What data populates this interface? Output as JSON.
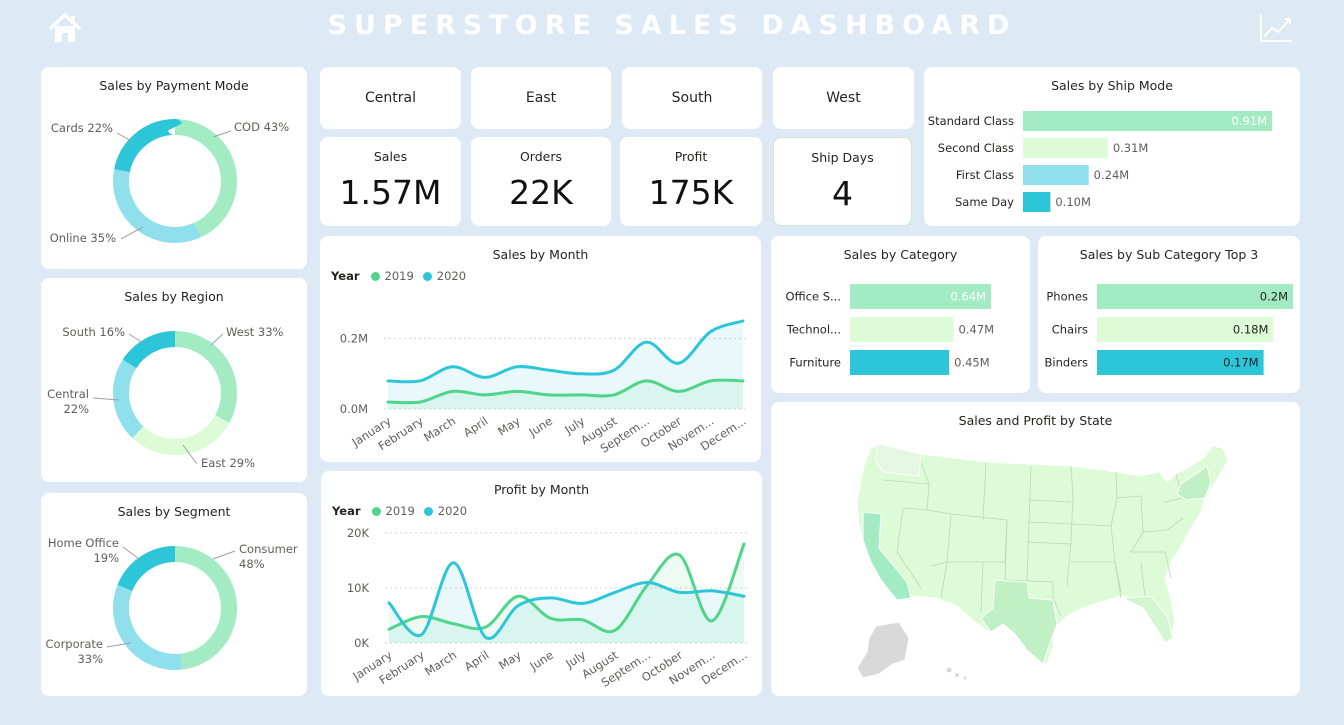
{
  "header": {
    "title": "SUPERSTORE SALES DASHBOARD",
    "home_icon": "home-icon",
    "trend_icon": "line-chart-icon"
  },
  "colors": {
    "background": "#dde9f5",
    "mint": "#a3ecc3",
    "pale_green": "#dcfbd6",
    "light_cyan": "#8fe0ec",
    "cyan": "#2cc6d8",
    "series_2019": "#4fd48a",
    "series_2020": "#2cc6d8"
  },
  "regions": [
    "Central",
    "East",
    "South",
    "West"
  ],
  "kpis": [
    {
      "label": "Sales",
      "value": "1.57M"
    },
    {
      "label": "Orders",
      "value": "22K"
    },
    {
      "label": "Profit",
      "value": "175K"
    },
    {
      "label": "Ship Days",
      "value": "4"
    }
  ],
  "donuts": {
    "payment": {
      "title": "Sales by Payment Mode",
      "slices": [
        {
          "label": "COD 43%",
          "value": 43,
          "color": "#a3ecc3"
        },
        {
          "label": "Online 35%",
          "value": 35,
          "color": "#8fe0ec"
        },
        {
          "label": "Cards 22%",
          "value": 22,
          "color": "#2cc6d8"
        }
      ]
    },
    "region": {
      "title": "Sales by Region",
      "slices": [
        {
          "label": "West 33%",
          "value": 33,
          "color": "#a3ecc3"
        },
        {
          "label": "East 29%",
          "value": 29,
          "color": "#dcfbd6"
        },
        {
          "label": "Central 22%",
          "value": 22,
          "color": "#8fe0ec"
        },
        {
          "label": "South 16%",
          "value": 16,
          "color": "#2cc6d8"
        }
      ]
    },
    "segment": {
      "title": "Sales by Segment",
      "slices": [
        {
          "label": "Consumer 48%",
          "value": 48,
          "color": "#a3ecc3"
        },
        {
          "label": "Corporate 33%",
          "value": 33,
          "color": "#8fe0ec"
        },
        {
          "label": "Home Office 19%",
          "value": 19,
          "color": "#2cc6d8"
        }
      ]
    }
  },
  "chart_data": [
    {
      "id": "sales-by-ship-mode",
      "type": "bar",
      "orientation": "horizontal",
      "title": "Sales by Ship Mode",
      "categories": [
        "Standard Class",
        "Second Class",
        "First Class",
        "Same Day"
      ],
      "values": [
        0.91,
        0.31,
        0.24,
        0.1
      ],
      "labels": [
        "0.91M",
        "0.31M",
        "0.24M",
        "0.10M"
      ],
      "colors": [
        "#a3ecc3",
        "#dcfbd6",
        "#8fe0ec",
        "#2cc6d8"
      ],
      "xlim": [
        0,
        0.91
      ]
    },
    {
      "id": "sales-by-category",
      "type": "bar",
      "orientation": "horizontal",
      "title": "Sales by Category",
      "categories": [
        "Office S...",
        "Technol...",
        "Furniture"
      ],
      "values": [
        0.64,
        0.47,
        0.45
      ],
      "labels": [
        "0.64M",
        "0.47M",
        "0.45M"
      ],
      "colors": [
        "#a3ecc3",
        "#dcfbd6",
        "#2cc6d8"
      ],
      "xlim": [
        0,
        0.64
      ]
    },
    {
      "id": "sales-by-subcategory",
      "type": "bar",
      "orientation": "horizontal",
      "title": "Sales by Sub Category Top 3",
      "categories": [
        "Phones",
        "Chairs",
        "Binders"
      ],
      "values": [
        0.2,
        0.18,
        0.17
      ],
      "labels": [
        "0.2M",
        "0.18M",
        "0.17M"
      ],
      "colors": [
        "#a3ecc3",
        "#dcfbd6",
        "#2cc6d8"
      ],
      "xlim": [
        0,
        0.2
      ]
    },
    {
      "id": "sales-by-month",
      "type": "area",
      "title": "Sales by Month",
      "legend_title": "Year",
      "categories": [
        "January",
        "February",
        "March",
        "April",
        "May",
        "June",
        "July",
        "August",
        "Septem...",
        "October",
        "Novem...",
        "Decem..."
      ],
      "series": [
        {
          "name": "2019",
          "values": [
            0.02,
            0.02,
            0.05,
            0.04,
            0.05,
            0.04,
            0.04,
            0.04,
            0.08,
            0.05,
            0.08,
            0.08
          ],
          "color": "#4fd48a"
        },
        {
          "name": "2020",
          "values": [
            0.08,
            0.08,
            0.12,
            0.09,
            0.12,
            0.11,
            0.1,
            0.11,
            0.19,
            0.13,
            0.22,
            0.25
          ],
          "color": "#2cc6d8"
        }
      ],
      "y_ticks": [
        "0.0M",
        "0.2M"
      ],
      "ylim": [
        0,
        0.25
      ]
    },
    {
      "id": "profit-by-month",
      "type": "area",
      "title": "Profit by Month",
      "legend_title": "Year",
      "categories": [
        "January",
        "February",
        "March",
        "April",
        "May",
        "June",
        "July",
        "August",
        "Septem...",
        "October",
        "Novem...",
        "Decem..."
      ],
      "series": [
        {
          "name": "2019",
          "values": [
            2500,
            4800,
            3500,
            2900,
            8500,
            4500,
            4200,
            2300,
            10500,
            16000,
            4000,
            18000
          ],
          "color": "#4fd48a"
        },
        {
          "name": "2020",
          "values": [
            7300,
            1500,
            14600,
            1000,
            6800,
            8200,
            7200,
            9200,
            11000,
            9200,
            9500,
            8500
          ],
          "color": "#2cc6d8"
        }
      ],
      "y_ticks": [
        "0K",
        "10K",
        "20K"
      ],
      "ylim": [
        0,
        20000
      ]
    }
  ],
  "map": {
    "title": "Sales and Profit by State",
    "fill": "#dcfbd6",
    "fill_mid": "#c2f0c5",
    "fill_high": "#a3ecc3",
    "fill_alaska": "#d9d9d9"
  }
}
